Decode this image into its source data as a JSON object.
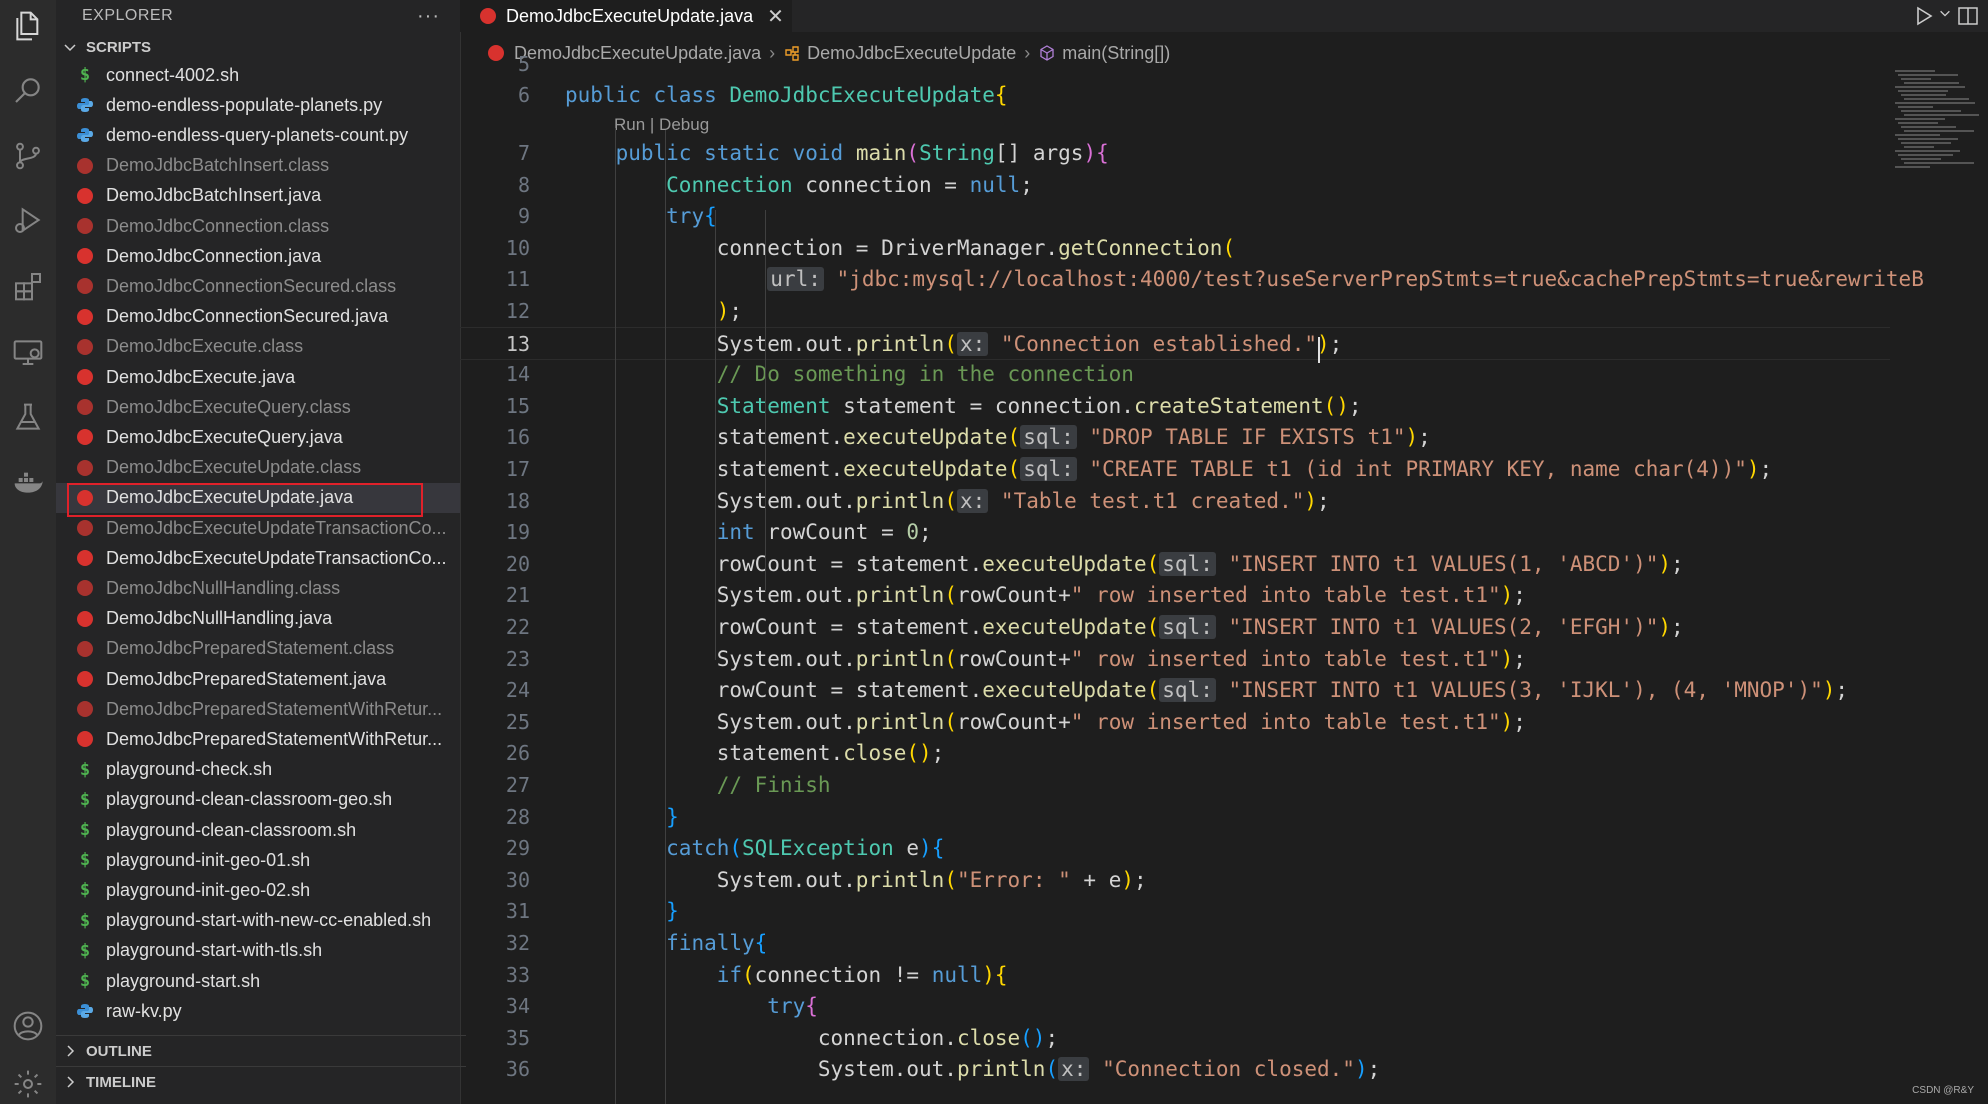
{
  "sidebar": {
    "title": "EXPLORER",
    "more": "···",
    "section": "SCRIPTS",
    "files": [
      {
        "name": "connect-4002.sh",
        "type": "sh",
        "dim": false
      },
      {
        "name": "demo-endless-populate-planets.py",
        "type": "py",
        "dim": false
      },
      {
        "name": "demo-endless-query-planets-count.py",
        "type": "py",
        "dim": false
      },
      {
        "name": "DemoJdbcBatchInsert.class",
        "type": "java",
        "dim": true
      },
      {
        "name": "DemoJdbcBatchInsert.java",
        "type": "java",
        "dim": false
      },
      {
        "name": "DemoJdbcConnection.class",
        "type": "java",
        "dim": true
      },
      {
        "name": "DemoJdbcConnection.java",
        "type": "java",
        "dim": false
      },
      {
        "name": "DemoJdbcConnectionSecured.class",
        "type": "java",
        "dim": true
      },
      {
        "name": "DemoJdbcConnectionSecured.java",
        "type": "java",
        "dim": false
      },
      {
        "name": "DemoJdbcExecute.class",
        "type": "java",
        "dim": true
      },
      {
        "name": "DemoJdbcExecute.java",
        "type": "java",
        "dim": false
      },
      {
        "name": "DemoJdbcExecuteQuery.class",
        "type": "java",
        "dim": true
      },
      {
        "name": "DemoJdbcExecuteQuery.java",
        "type": "java",
        "dim": false
      },
      {
        "name": "DemoJdbcExecuteUpdate.class",
        "type": "java",
        "dim": true
      },
      {
        "name": "DemoJdbcExecuteUpdate.java",
        "type": "java",
        "dim": false,
        "selected": true
      },
      {
        "name": "DemoJdbcExecuteUpdateTransactionCo...",
        "type": "java",
        "dim": true
      },
      {
        "name": "DemoJdbcExecuteUpdateTransactionCo...",
        "type": "java",
        "dim": false
      },
      {
        "name": "DemoJdbcNullHandling.class",
        "type": "java",
        "dim": true
      },
      {
        "name": "DemoJdbcNullHandling.java",
        "type": "java",
        "dim": false
      },
      {
        "name": "DemoJdbcPreparedStatement.class",
        "type": "java",
        "dim": true
      },
      {
        "name": "DemoJdbcPreparedStatement.java",
        "type": "java",
        "dim": false
      },
      {
        "name": "DemoJdbcPreparedStatementWithRetur...",
        "type": "java",
        "dim": true
      },
      {
        "name": "DemoJdbcPreparedStatementWithRetur...",
        "type": "java",
        "dim": false
      },
      {
        "name": "playground-check.sh",
        "type": "sh",
        "dim": false
      },
      {
        "name": "playground-clean-classroom-geo.sh",
        "type": "sh",
        "dim": false
      },
      {
        "name": "playground-clean-classroom.sh",
        "type": "sh",
        "dim": false
      },
      {
        "name": "playground-init-geo-01.sh",
        "type": "sh",
        "dim": false
      },
      {
        "name": "playground-init-geo-02.sh",
        "type": "sh",
        "dim": false
      },
      {
        "name": "playground-start-with-new-cc-enabled.sh",
        "type": "sh",
        "dim": false
      },
      {
        "name": "playground-start-with-tls.sh",
        "type": "sh",
        "dim": false
      },
      {
        "name": "playground-start.sh",
        "type": "sh",
        "dim": false
      },
      {
        "name": "raw-kv.py",
        "type": "py",
        "dim": false
      }
    ],
    "outline_label": "OUTLINE",
    "timeline_label": "TIMELINE"
  },
  "tab": {
    "label": "DemoJdbcExecuteUpdate.java",
    "close": "✕"
  },
  "breadcrumb": {
    "file": "DemoJdbcExecuteUpdate.java",
    "class": "DemoJdbcExecuteUpdate",
    "method": "main(String[])"
  },
  "editor": {
    "codelens": "Run | Debug",
    "current_line": 13,
    "lines": [
      {
        "n": 5,
        "html": ""
      },
      {
        "n": 6,
        "html": "<span class='kw'>public</span> <span class='kw'>class</span> <span class='ty'>DemoJdbcExecuteUpdate</span><span class='br1'>{</span>"
      },
      {
        "n": 7,
        "html": "    <span class='kw'>public</span> <span class='kw'>static</span> <span class='kw'>void</span> <span class='fn'>main</span><span class='br2'>(</span><span class='ty'>String</span>[] args<span class='br2'>)</span><span class='br2'>{</span>"
      },
      {
        "n": 8,
        "html": "        <span class='ty'>Connection</span> connection = <span class='kw'>null</span>;"
      },
      {
        "n": 9,
        "html": "        <span class='kw'>try</span><span class='br3'>{</span>"
      },
      {
        "n": 10,
        "html": "            connection = DriverManager.<span class='fn'>getConnection</span><span class='br1'>(</span>"
      },
      {
        "n": 11,
        "html": "                <span class='hint'>url:</span> <span class='str'>\"jdbc:mysql://localhost:4000/test?useServerPrepStmts=true&amp;cachePrepStmts=true&amp;rewriteB</span>"
      },
      {
        "n": 12,
        "html": "            <span class='br1'>)</span>;"
      },
      {
        "n": 13,
        "html": "            System.out.<span class='fn'>println</span><span class='br1'>(</span><span class='hint'>x:</span> <span class='str'>\"Connection established.\"</span><span class='br1'>)</span>;"
      },
      {
        "n": 14,
        "html": "            <span class='cm'>// Do something in the connection</span>"
      },
      {
        "n": 15,
        "html": "            <span class='ty'>Statement</span> statement = connection.<span class='fn'>createStatement</span><span class='br1'>()</span>;"
      },
      {
        "n": 16,
        "html": "            statement.<span class='fn'>executeUpdate</span><span class='br1'>(</span><span class='hint'>sql:</span> <span class='str'>\"DROP TABLE IF EXISTS t1\"</span><span class='br1'>)</span>;"
      },
      {
        "n": 17,
        "html": "            statement.<span class='fn'>executeUpdate</span><span class='br1'>(</span><span class='hint'>sql:</span> <span class='str'>\"CREATE TABLE t1 (id int PRIMARY KEY, name char(4))\"</span><span class='br1'>)</span>;"
      },
      {
        "n": 18,
        "html": "            System.out.<span class='fn'>println</span><span class='br1'>(</span><span class='hint'>x:</span> <span class='str'>\"Table test.t1 created.\"</span><span class='br1'>)</span>;"
      },
      {
        "n": 19,
        "html": "            <span class='kw'>int</span> rowCount = <span class='num'>0</span>;"
      },
      {
        "n": 20,
        "html": "            rowCount = statement.<span class='fn'>executeUpdate</span><span class='br1'>(</span><span class='hint'>sql:</span> <span class='str'>\"INSERT INTO t1 VALUES(1, 'ABCD')\"</span><span class='br1'>)</span>;"
      },
      {
        "n": 21,
        "html": "            System.out.<span class='fn'>println</span><span class='br1'>(</span>rowCount+<span class='str'>\" row inserted into table test.t1\"</span><span class='br1'>)</span>;"
      },
      {
        "n": 22,
        "html": "            rowCount = statement.<span class='fn'>executeUpdate</span><span class='br1'>(</span><span class='hint'>sql:</span> <span class='str'>\"INSERT INTO t1 VALUES(2, 'EFGH')\"</span><span class='br1'>)</span>;"
      },
      {
        "n": 23,
        "html": "            System.out.<span class='fn'>println</span><span class='br1'>(</span>rowCount+<span class='str'>\" row inserted into table test.t1\"</span><span class='br1'>)</span>;"
      },
      {
        "n": 24,
        "html": "            rowCount = statement.<span class='fn'>executeUpdate</span><span class='br1'>(</span><span class='hint'>sql:</span> <span class='str'>\"INSERT INTO t1 VALUES(3, 'IJKL'), (4, 'MNOP')\"</span><span class='br1'>)</span>;"
      },
      {
        "n": 25,
        "html": "            System.out.<span class='fn'>println</span><span class='br1'>(</span>rowCount+<span class='str'>\" row inserted into table test.t1\"</span><span class='br1'>)</span>;"
      },
      {
        "n": 26,
        "html": "            statement.<span class='fn'>close</span><span class='br1'>()</span>;"
      },
      {
        "n": 27,
        "html": "            <span class='cm'>// Finish</span>"
      },
      {
        "n": 28,
        "html": "        <span class='br3'>}</span>"
      },
      {
        "n": 29,
        "html": "        <span class='kw'>catch</span><span class='br3'>(</span><span class='ty'>SQLException</span> e<span class='br3'>)</span><span class='br3'>{</span>"
      },
      {
        "n": 30,
        "html": "            System.out.<span class='fn'>println</span><span class='br1'>(</span><span class='str'>\"Error: \"</span> + e<span class='br1'>)</span>;"
      },
      {
        "n": 31,
        "html": "        <span class='br3'>}</span>"
      },
      {
        "n": 32,
        "html": "        <span class='kw'>finally</span><span class='br3'>{</span>"
      },
      {
        "n": 33,
        "html": "            <span class='kw'>if</span><span class='br1'>(</span>connection != <span class='kw'>null</span><span class='br1'>)</span><span class='br1'>{</span>"
      },
      {
        "n": 34,
        "html": "                <span class='kw'>try</span><span class='br2'>{</span>"
      },
      {
        "n": 35,
        "html": "                    connection.<span class='fn'>close</span><span class='br3'>()</span>;"
      },
      {
        "n": 36,
        "html": "                    System.out.<span class='fn'>println</span><span class='br3'>(</span><span class='hint'>x:</span> <span class='str'>\"Connection closed.\"</span><span class='br3'>)</span>;"
      }
    ]
  },
  "watermark": "CSDN @R&Y",
  "colors": {
    "accent_selection": "#e0212a",
    "java_icon": "#d8322e",
    "sh_icon": "#4fb350",
    "py_icon": "#3b8fd6"
  },
  "icons": [
    "files-icon",
    "search-icon",
    "source-control-icon",
    "run-debug-icon",
    "extensions-icon",
    "remote-explorer-icon",
    "testing-icon",
    "docker-icon",
    "account-icon",
    "settings-icon"
  ]
}
